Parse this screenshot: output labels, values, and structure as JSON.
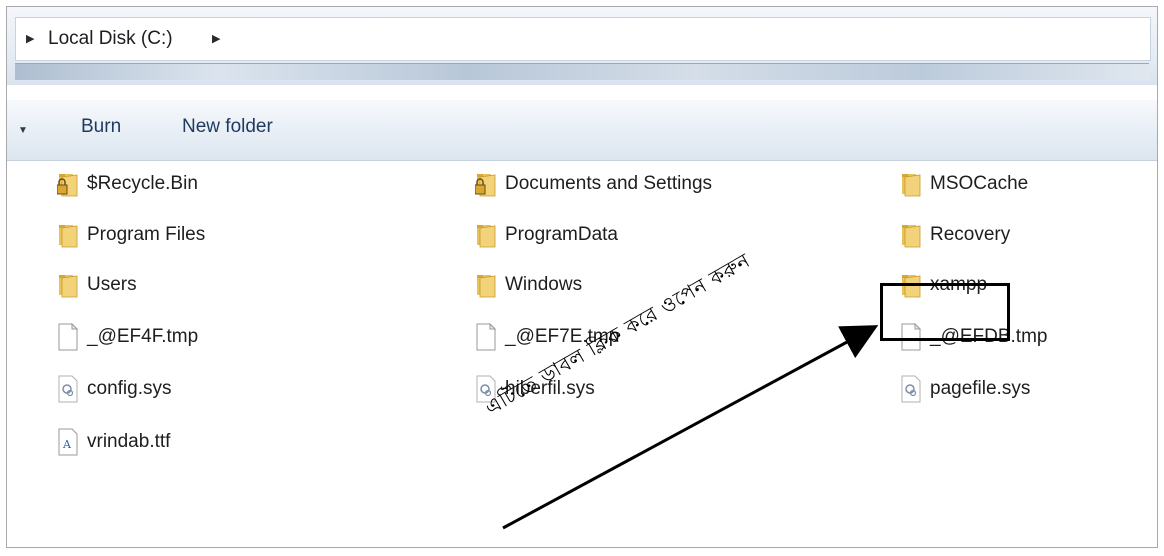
{
  "address": {
    "path": "Local Disk (C:)"
  },
  "toolbar": {
    "burn_label": "Burn",
    "new_folder_label": "New folder"
  },
  "files": [
    {
      "name": "$Recycle.Bin",
      "icon": "locked-folder-icon"
    },
    {
      "name": "Documents and Settings",
      "icon": "locked-folder-icon"
    },
    {
      "name": "MSOCache",
      "icon": "folder-icon"
    },
    {
      "name": "Program Files",
      "icon": "folder-icon"
    },
    {
      "name": "ProgramData",
      "icon": "folder-icon"
    },
    {
      "name": "Recovery",
      "icon": "folder-icon"
    },
    {
      "name": "Users",
      "icon": "folder-icon"
    },
    {
      "name": "Windows",
      "icon": "folder-icon"
    },
    {
      "name": "xampp",
      "icon": "folder-icon"
    },
    {
      "name": "_@EF4F.tmp",
      "icon": "file-icon"
    },
    {
      "name": "_@EF7E.tmp",
      "icon": "file-icon"
    },
    {
      "name": "_@EFDB.tmp",
      "icon": "file-icon"
    },
    {
      "name": "config.sys",
      "icon": "system-file-icon"
    },
    {
      "name": "hiberfil.sys",
      "icon": "system-file-icon"
    },
    {
      "name": "pagefile.sys",
      "icon": "system-file-icon"
    },
    {
      "name": "vrindab.ttf",
      "icon": "font-file-icon"
    }
  ],
  "annotation": {
    "text": "এটিতে ডাবল ক্লিক করে ওপেন করুন"
  }
}
